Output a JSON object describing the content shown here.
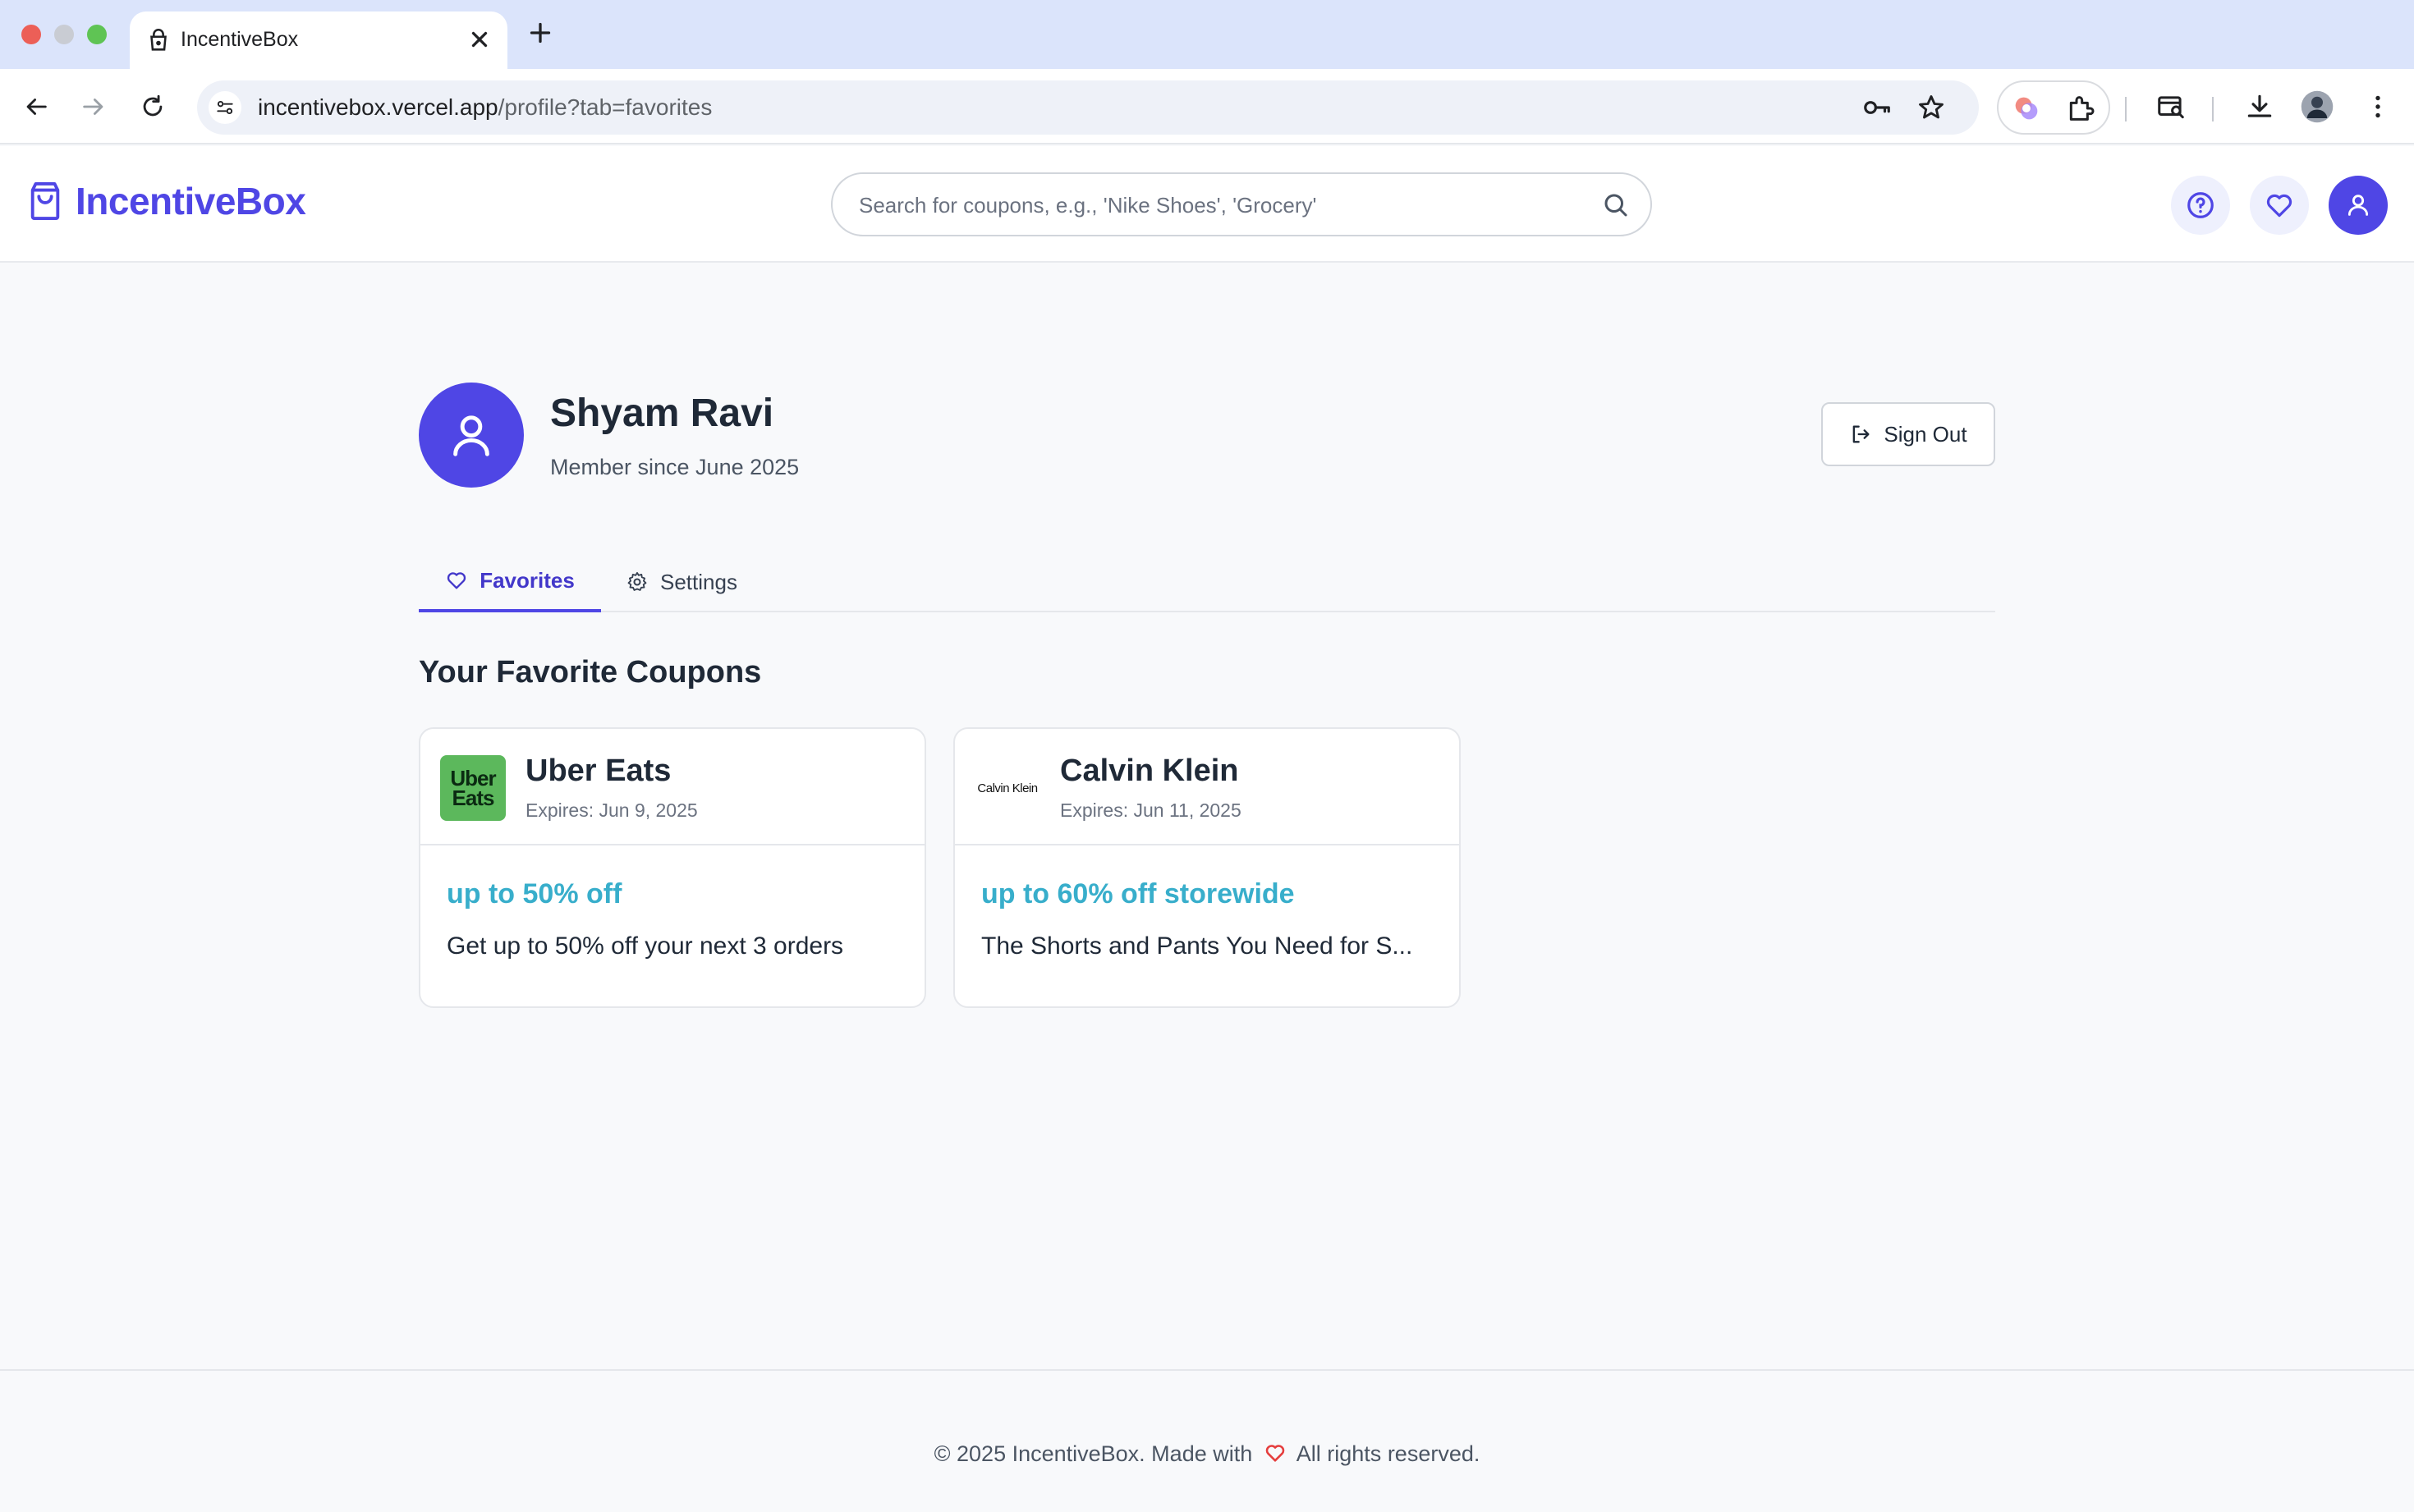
{
  "browser": {
    "tab_title": "IncentiveBox",
    "url_domain": "incentivebox.vercel.app",
    "url_path": "/profile?tab=favorites"
  },
  "header": {
    "logo_text": "IncentiveBox",
    "search_placeholder": "Search for coupons, e.g., 'Nike Shoes', 'Grocery'"
  },
  "profile": {
    "name": "Shyam Ravi",
    "member_since": "Member since June 2025",
    "signout_label": "Sign Out"
  },
  "tabs": [
    {
      "label": "Favorites",
      "active": true
    },
    {
      "label": "Settings",
      "active": false
    }
  ],
  "favorites": {
    "title": "Your Favorite Coupons",
    "cards": [
      {
        "brand": "Uber Eats",
        "logo_text_line1": "Uber",
        "logo_text_line2": "Eats",
        "expires": "Expires: Jun 9, 2025",
        "offer": "up to 50% off",
        "description": "Get up to 50% off your next 3 orders"
      },
      {
        "brand": "Calvin Klein",
        "logo_text": "Calvin Klein",
        "expires": "Expires: Jun 11, 2025",
        "offer": "up to 60% off storewide",
        "description": "The Shorts and Pants You Need for S..."
      }
    ]
  },
  "footer": {
    "text_before": "© 2025 IncentiveBox. Made with",
    "text_after": "All rights reserved."
  },
  "colors": {
    "brand": "#4f46e5",
    "offer": "#38aecb",
    "heart": "#e53e3e"
  }
}
